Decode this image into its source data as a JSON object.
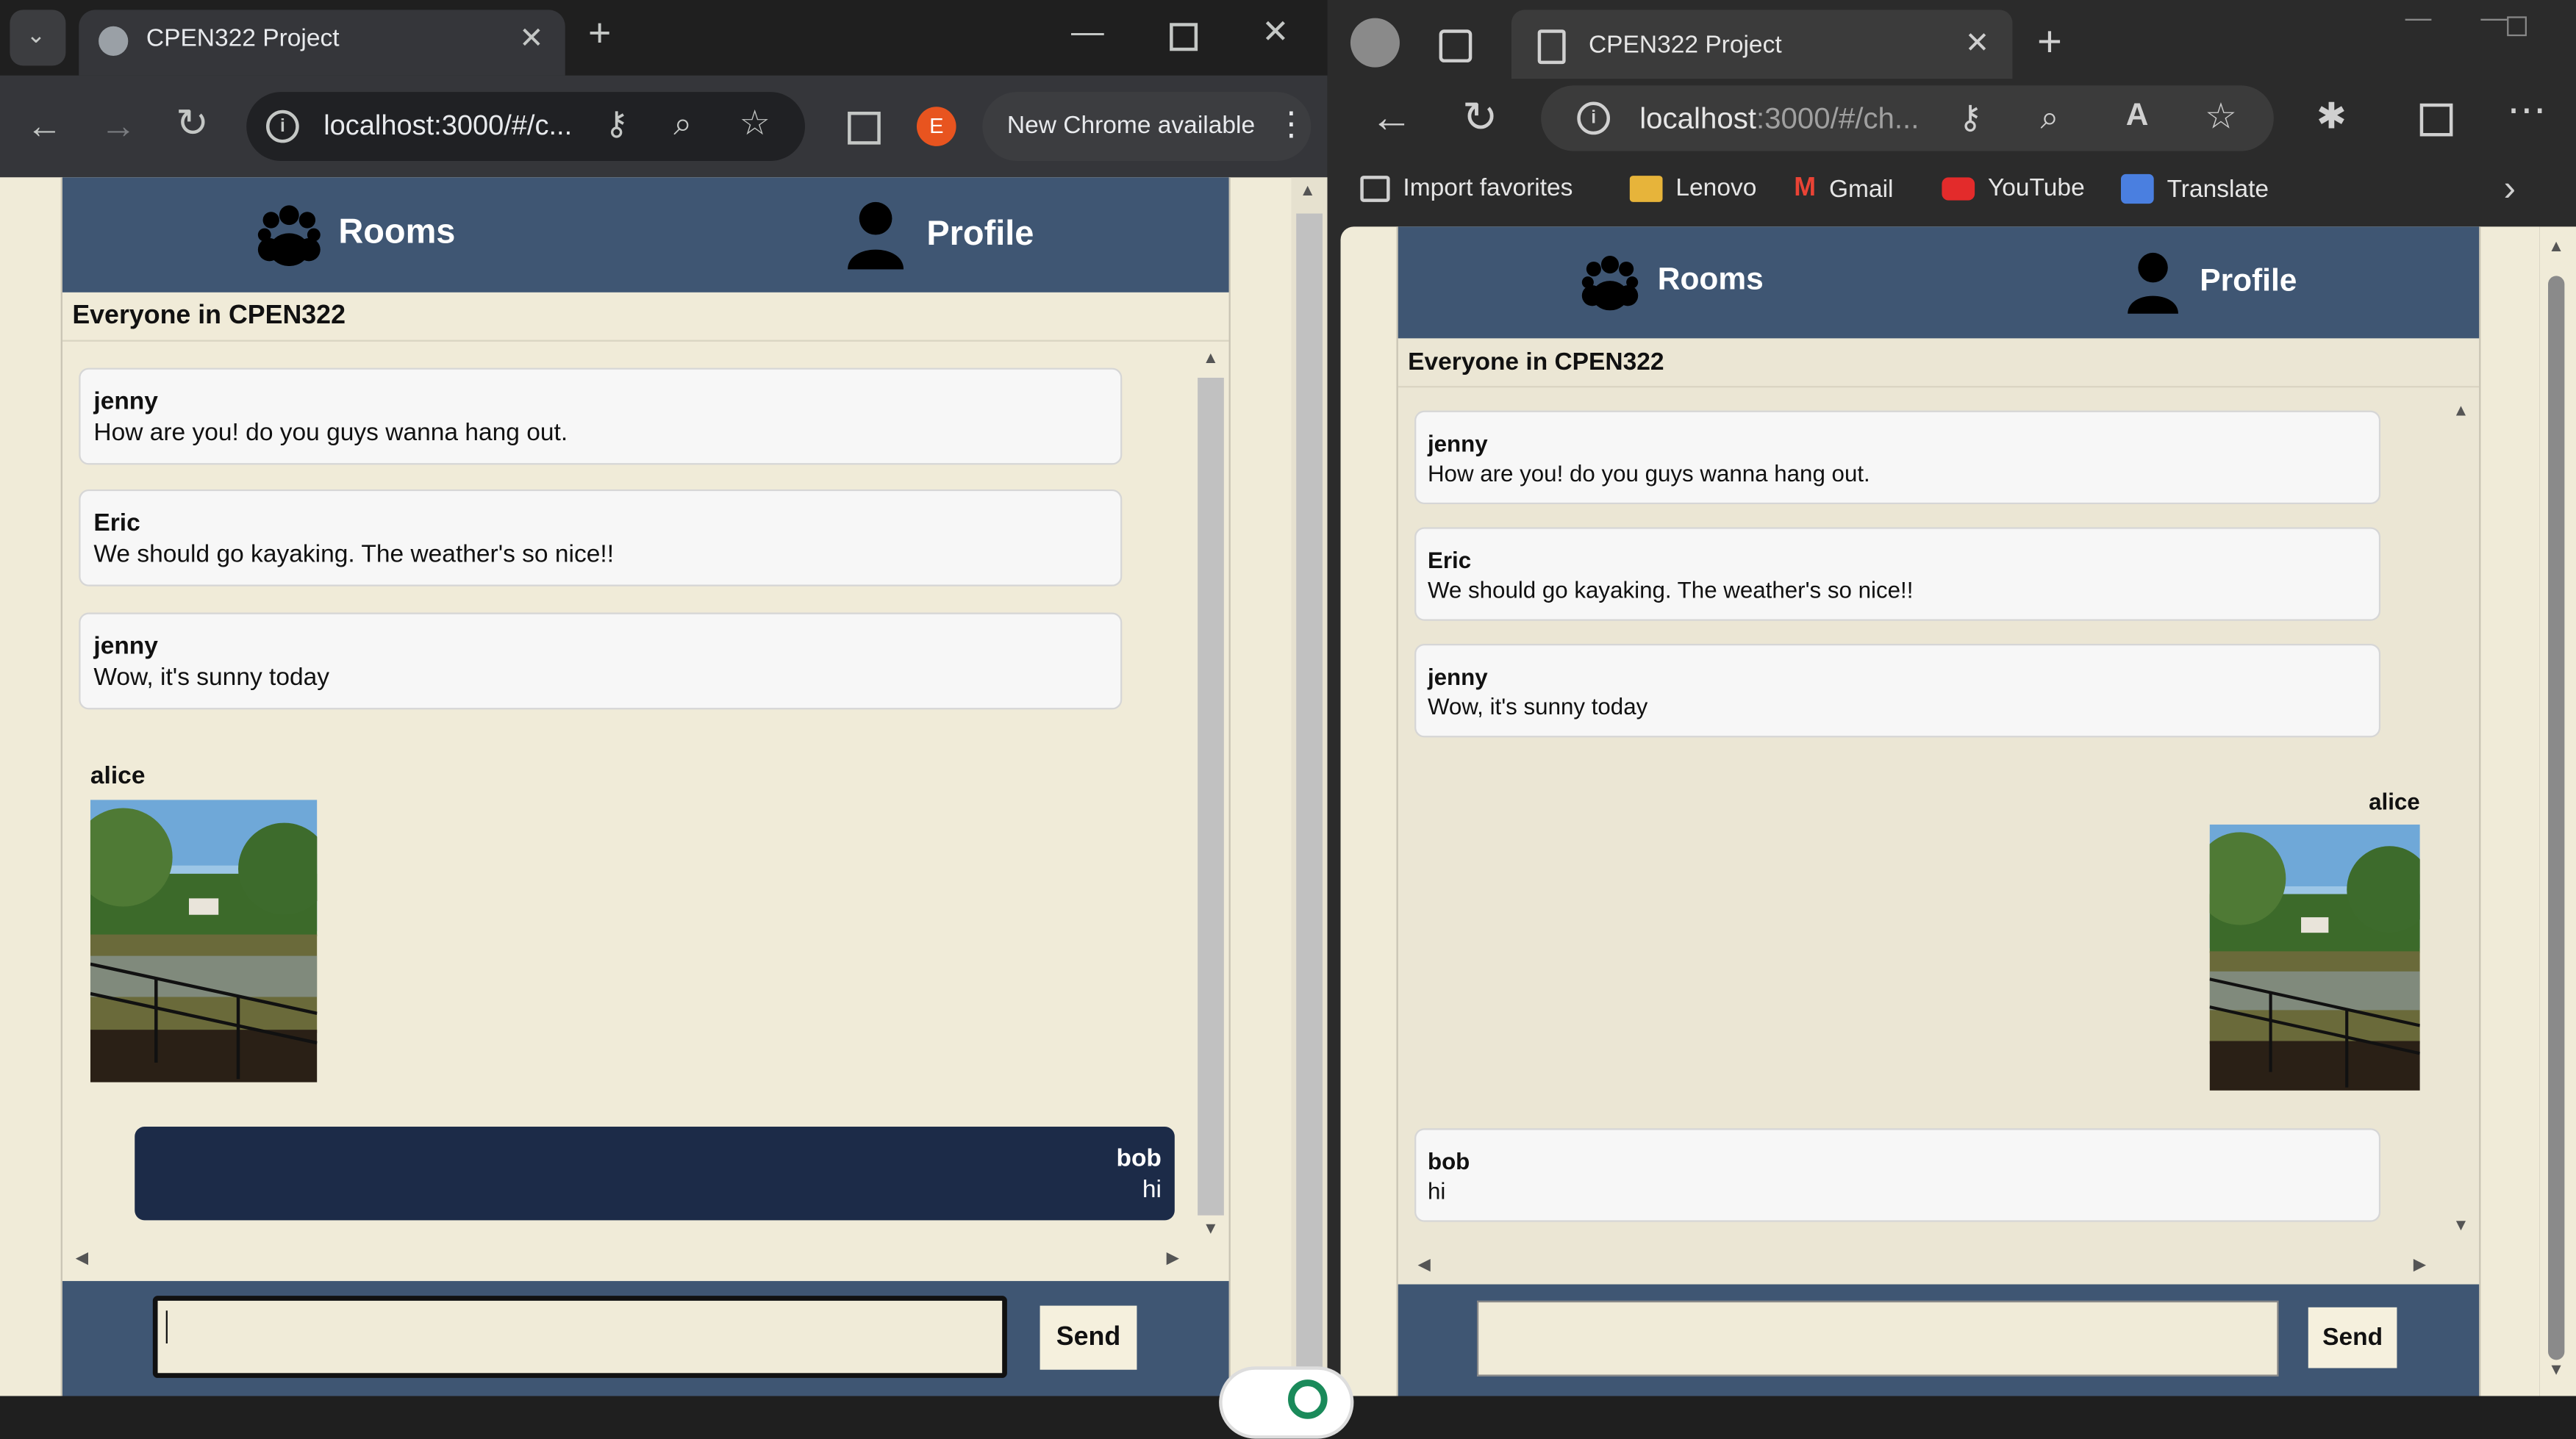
{
  "left_browser": {
    "tab_title": "CPEN322 Project",
    "url": "localhost:3000/#/c...",
    "profile_initial": "E",
    "update_label": "New Chrome available"
  },
  "right_browser": {
    "tab_title": "CPEN322 Project",
    "url_host": "localhost",
    "url_rest": ":3000/#/ch...",
    "bookmarks": [
      "Import favorites",
      "Lenovo",
      "Gmail",
      "YouTube",
      "Translate"
    ]
  },
  "app": {
    "nav": {
      "rooms": "Rooms",
      "profile": "Profile"
    },
    "room_title": "Everyone in CPEN322",
    "messages": [
      {
        "author": "jenny",
        "text": "How are you! do you guys wanna hang out."
      },
      {
        "author": "Eric",
        "text": "We should go kayaking. The weather's so nice!!"
      },
      {
        "author": "jenny",
        "text": "Wow, it's sunny today"
      },
      {
        "author": "alice",
        "text": ""
      },
      {
        "author": "bob",
        "text": "hi"
      }
    ],
    "send_label": "Send"
  },
  "colors": {
    "navbar": "#3f5673",
    "page_background": "#f0ebd8",
    "own_message": "#1c2b48"
  }
}
